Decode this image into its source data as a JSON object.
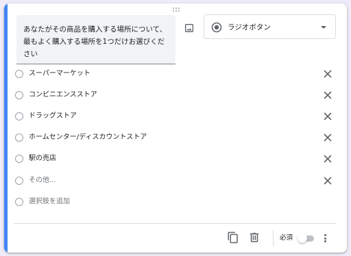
{
  "question": {
    "title": "あなたがその商品を購入する場所について、最もよく購入する場所を1つだけお選びください"
  },
  "type_select": {
    "icon": "radio-checked-icon",
    "label": "ラジオボタン"
  },
  "options": [
    {
      "label": "スーパーマーケット"
    },
    {
      "label": "コンビニエンスストア"
    },
    {
      "label": "ドラッグストア"
    },
    {
      "label": "ホームセンター/ディスカウントストア"
    },
    {
      "label": "駅の売店"
    }
  ],
  "other_option": {
    "label": "その他..."
  },
  "add_option": {
    "label": "選択肢を追加"
  },
  "footer": {
    "required_label": "必須",
    "required_on": false
  },
  "colors": {
    "accent": "#4285f4",
    "background": "#f0ebf8"
  }
}
